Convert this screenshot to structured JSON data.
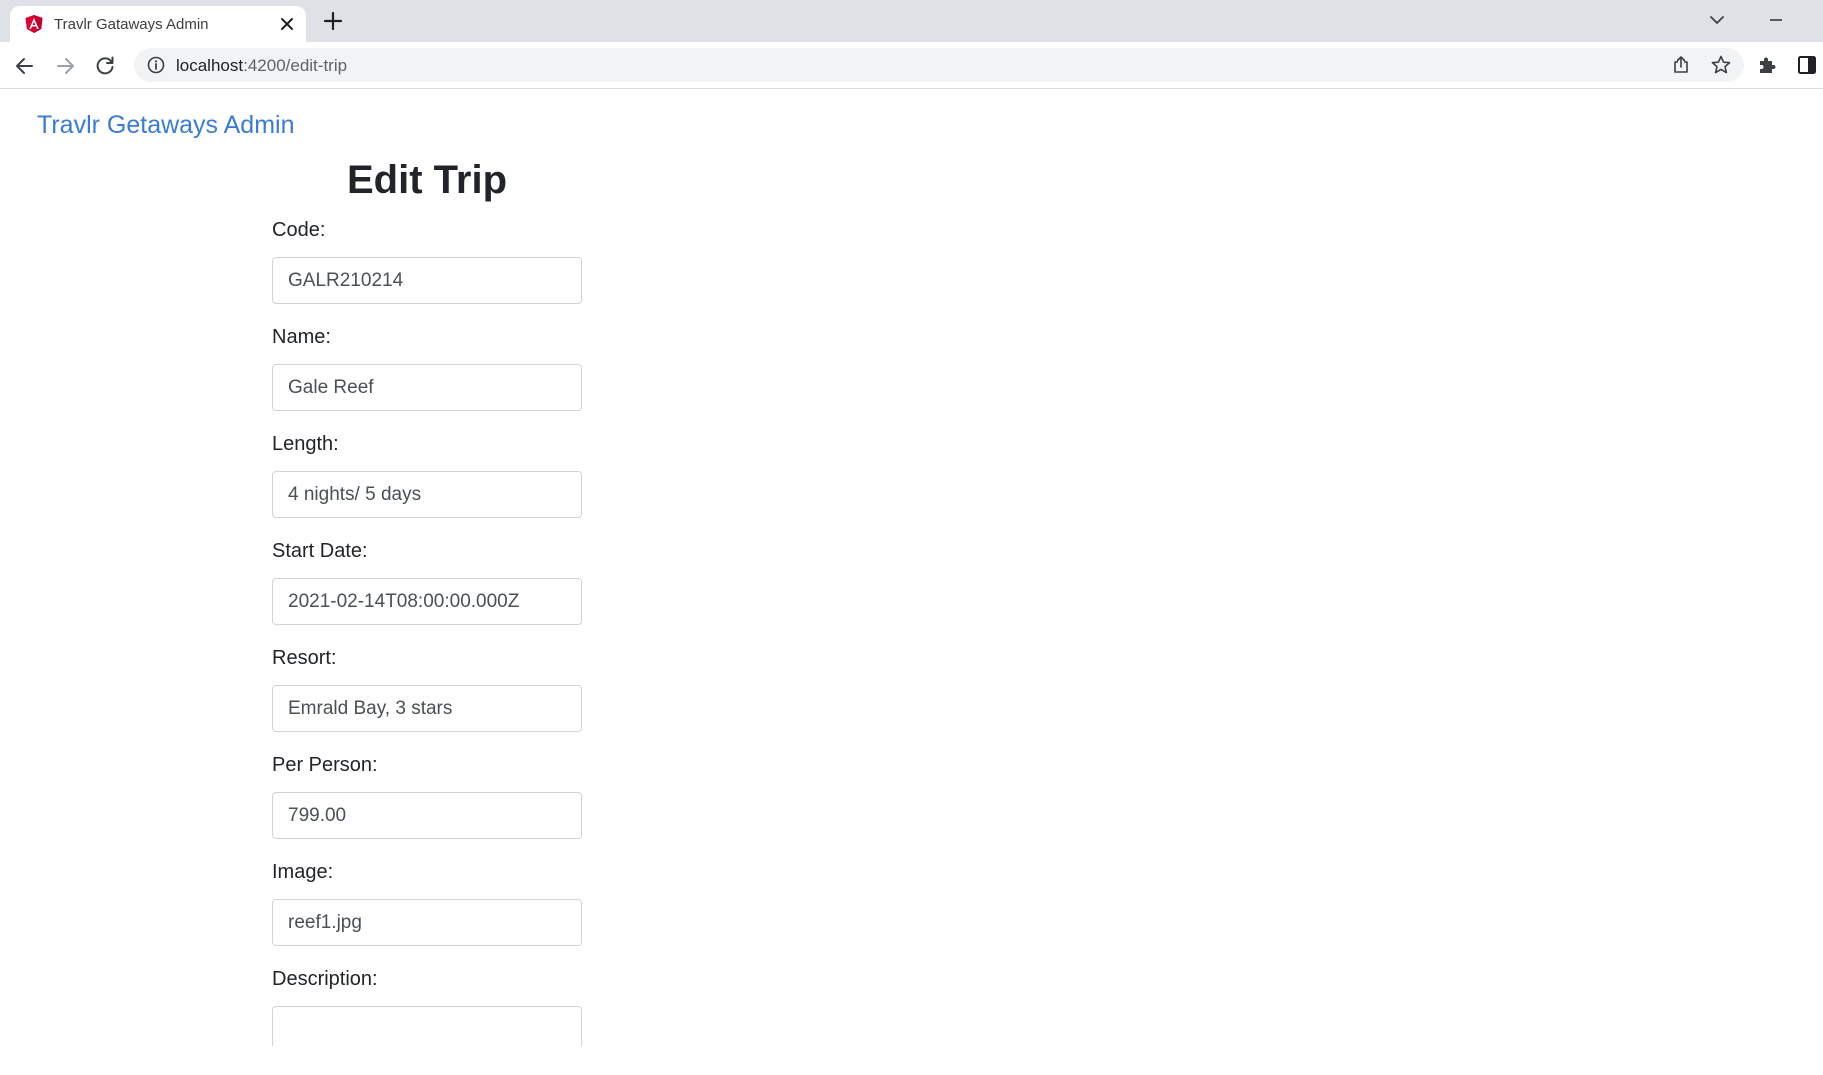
{
  "browser": {
    "tab_title": "Travlr Gataways Admin",
    "url_host": "localhost",
    "url_path": ":4200/edit-trip"
  },
  "icons": {
    "favicon": "angular-logo-icon",
    "tab_close": "close-icon",
    "new_tab": "plus-icon",
    "tab_search": "chevron-down-icon",
    "minimize": "minimize-icon",
    "back": "arrow-left-icon",
    "forward": "arrow-right-icon",
    "reload": "reload-icon",
    "site_info": "info-icon",
    "share": "share-icon",
    "bookmark": "star-icon",
    "extensions": "puzzle-icon",
    "side_panel": "side-panel-icon"
  },
  "colors": {
    "brand_link": "#3a7bd5",
    "angular_red": "#dd0031"
  },
  "header": {
    "brand": "Travlr Getaways Admin"
  },
  "main": {
    "title": "Edit Trip",
    "fields": [
      {
        "label": "Code:",
        "value": "GALR210214"
      },
      {
        "label": "Name:",
        "value": "Gale Reef"
      },
      {
        "label": "Length:",
        "value": "4 nights/ 5 days"
      },
      {
        "label": "Start Date:",
        "value": "2021-02-14T08:00:00.000Z"
      },
      {
        "label": "Resort:",
        "value": "Emrald Bay, 3 stars"
      },
      {
        "label": "Per Person:",
        "value": "799.00"
      },
      {
        "label": "Image:",
        "value": "reef1.jpg"
      },
      {
        "label": "Description:",
        "value": ""
      }
    ]
  }
}
